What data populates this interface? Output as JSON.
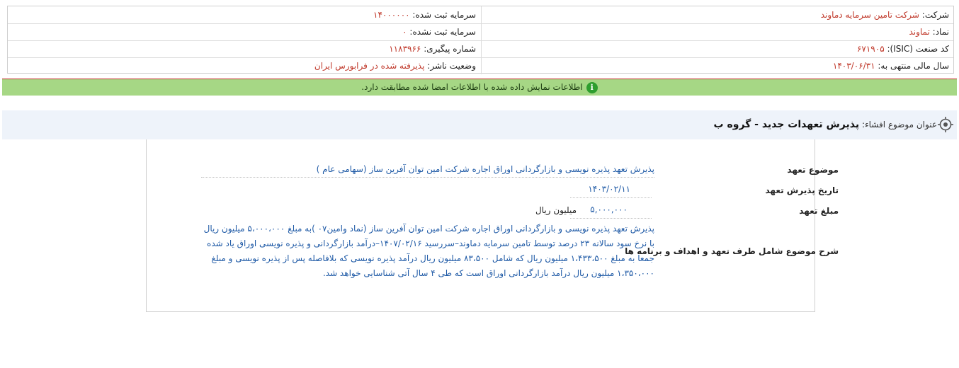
{
  "company": {
    "company_label": "شرکت:",
    "company_value": "شرکت تامین سرمایه دماوند",
    "registered_capital_label": "سرمایه ثبت شده:",
    "registered_capital_value": "۱۴۰۰۰۰۰۰",
    "symbol_label": "نماد:",
    "symbol_value": "تماوند",
    "unregistered_capital_label": "سرمایه ثبت نشده:",
    "unregistered_capital_value": "۰",
    "isic_label": "کد صنعت (ISIC):",
    "isic_value": "۶۷۱۹۰۵",
    "tracking_label": "شماره پیگیری:",
    "tracking_value": "۱۱۸۳۹۶۶",
    "fiscal_year_label": "سال مالی منتهی به:",
    "fiscal_year_value": "۱۴۰۳/۰۶/۳۱",
    "publisher_status_label": "وضعیت ناشر:",
    "publisher_status_value": "پذیرفته شده در فرابورس ایران"
  },
  "status": {
    "icon": "info-icon",
    "text": "اطلاعات نمایش داده شده با اطلاعات امضا شده مطابقت دارد."
  },
  "subject": {
    "label": "عنوان موضوع افشاء:",
    "title": "پذیرش تعهدات جدید - گروه ب",
    "icon": "target-icon"
  },
  "form": {
    "topic_label": "موضوع تعهد",
    "topic_value": "پذیرش تعهد پذیره نویسی و بازارگردانی اوراق اجاره شرکت امین توان آفرین ساز (سهامی عام )",
    "date_label": "تاریخ پذیرش تعهد",
    "date_value": "۱۴۰۳/۰۲/۱۱",
    "amount_label": "مبلغ تعهد",
    "amount_value": "۵,۰۰۰,۰۰۰",
    "amount_unit": "میلیون ریال",
    "description_label": "شرح موضوع شامل طرف تعهد و اهداف و برنامه ها",
    "description_value": "پذیرش تعهد پذیره نویسی و بازارگردانی اوراق اجاره شرکت امین توان آفرین ساز (نماد وامین۰۷ )به مبلغ ۵،۰۰۰،۰۰۰ میلیون ریال با نرخ سود سالانه ۲۳ درصد توسط تامین سرمایه دماوند–سررسید ۱۴۰۷/۰۲/۱۶–درآمد بازارگردانی و پذیره نویسی اوراق یاد شده جمعا به مبلغ ۱،۴۳۳،۵۰۰ میلیون ریال که شامل ۸۳،۵۰۰ میلیون ریال درآمد پذیره نویسی که بلافاصله پس از پذیره نویسی و مبلغ ۱،۳۵۰،۰۰۰ میلیون ریال درآمد بازارگردانی اوراق است که طی ۴ سال آتی شناسایی خواهد شد."
  }
}
